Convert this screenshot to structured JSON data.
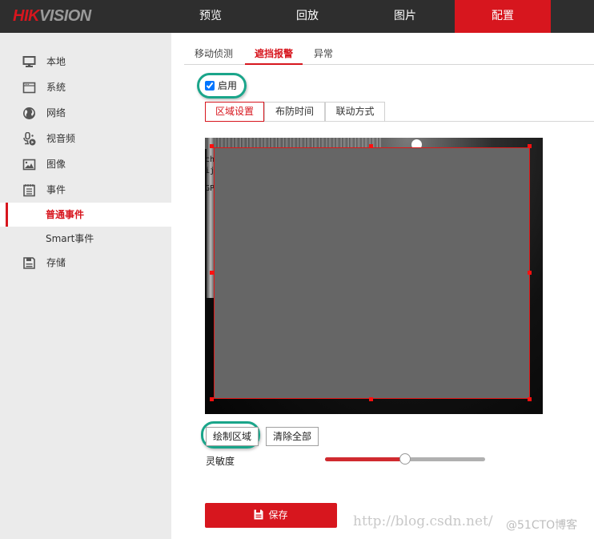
{
  "brand": {
    "logo_left": "HIK",
    "logo_right": "VISION",
    "accent": "#d7161e"
  },
  "topnav": {
    "items": [
      {
        "label": "预览",
        "active": false
      },
      {
        "label": "回放",
        "active": false
      },
      {
        "label": "图片",
        "active": false
      },
      {
        "label": "配置",
        "active": true
      }
    ]
  },
  "sidebar": {
    "items": [
      {
        "label": "本地",
        "icon": "monitor-icon"
      },
      {
        "label": "系统",
        "icon": "window-icon"
      },
      {
        "label": "网络",
        "icon": "globe-icon"
      },
      {
        "label": "视音频",
        "icon": "mic-play-icon"
      },
      {
        "label": "图像",
        "icon": "image-icon"
      },
      {
        "label": "事件",
        "icon": "notepad-icon"
      },
      {
        "label": "普通事件",
        "sub": true,
        "active": true
      },
      {
        "label": "Smart事件",
        "sub": true
      },
      {
        "label": "存储",
        "icon": "floppy-icon"
      }
    ]
  },
  "tabs": [
    {
      "label": "移动侦测",
      "active": false
    },
    {
      "label": "遮挡报警",
      "active": true
    },
    {
      "label": "异常",
      "active": false
    }
  ],
  "enable": {
    "label": "启用",
    "checked": true
  },
  "subtabs": [
    {
      "label": "区域设置",
      "active": true
    },
    {
      "label": "布防时间",
      "active": false
    },
    {
      "label": "联动方式",
      "active": false
    }
  ],
  "video": {
    "osd_lines": [
      "ch",
      "ij",
      "GP"
    ]
  },
  "buttons": {
    "draw_area": "绘制区域",
    "clear_all": "清除全部"
  },
  "sensitivity": {
    "label": "灵敏度",
    "value_percent": 50
  },
  "save": {
    "label": "保存"
  },
  "watermark": {
    "url": "http://blog.csdn.net/",
    "overlay": "@51CTO博客"
  }
}
